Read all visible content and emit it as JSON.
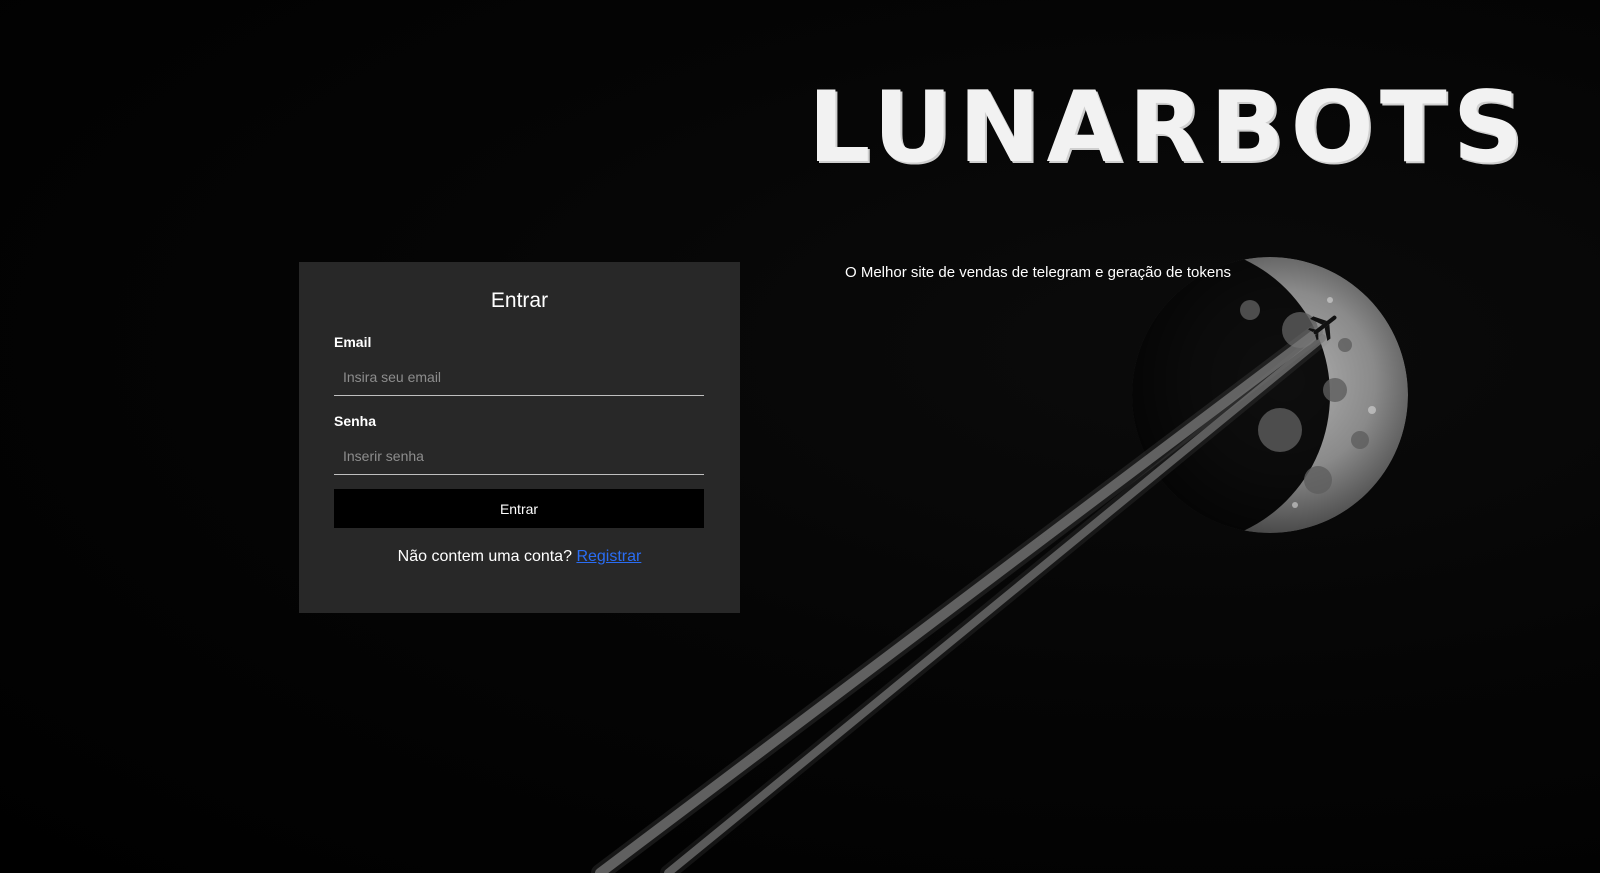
{
  "brand": {
    "logo_text": "LUNARBOTS",
    "tagline": "O Melhor site de vendas de telegram e geração de tokens"
  },
  "login": {
    "title": "Entrar",
    "email_label": "Email",
    "email_placeholder": "Insira seu email",
    "email_value": "",
    "password_label": "Senha",
    "password_placeholder": "Inserir senha",
    "password_value": "",
    "submit_label": "Entrar",
    "register_prompt": "Não contem uma conta?",
    "register_link": "Registrar"
  },
  "colors": {
    "page_background": "#000000",
    "card_background": "#282828",
    "button_background": "#000000",
    "link": "#2a6df4",
    "text": "#ffffff"
  },
  "icons": [
    "moon-image",
    "airplane-icon"
  ]
}
